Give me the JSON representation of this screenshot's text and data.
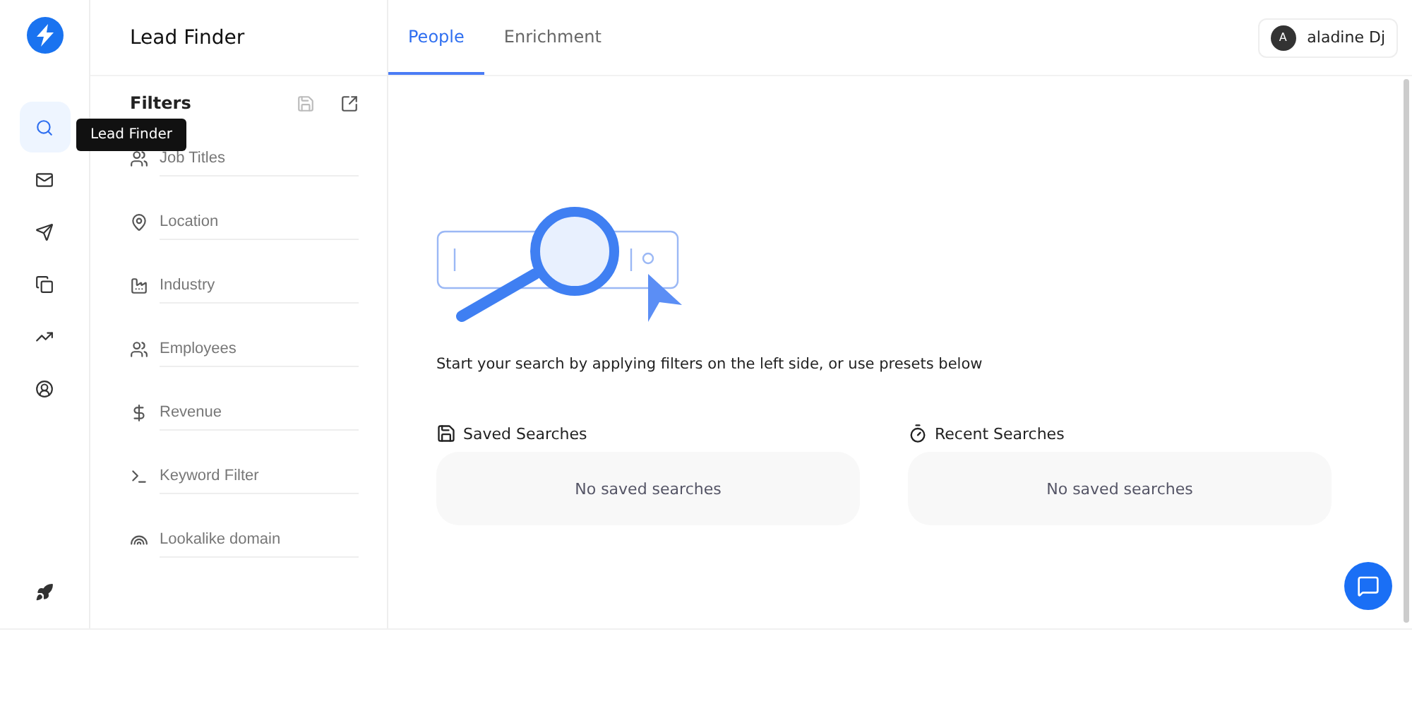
{
  "app": {
    "title": "Lead Finder"
  },
  "nav": [
    {
      "kind": "search",
      "selected": true
    },
    {
      "kind": "mail",
      "selected": false
    },
    {
      "kind": "send",
      "selected": false
    },
    {
      "kind": "copy",
      "selected": false
    },
    {
      "kind": "trend",
      "selected": false
    },
    {
      "kind": "user",
      "selected": false
    }
  ],
  "nav_bottom": {
    "kind": "rocket"
  },
  "tooltip": "Lead Finder",
  "filters": {
    "title": "Filters",
    "items": [
      {
        "kind": "users",
        "label": "Job Titles"
      },
      {
        "kind": "pin",
        "label": "Location"
      },
      {
        "kind": "building",
        "label": "Industry"
      },
      {
        "kind": "group",
        "label": "Employees"
      },
      {
        "kind": "dollar",
        "label": "Revenue"
      },
      {
        "kind": "terminal",
        "label": "Keyword Filter"
      },
      {
        "kind": "rainbow",
        "label": "Lookalike domain"
      }
    ]
  },
  "tabs": [
    {
      "label": "People",
      "selected": true
    },
    {
      "label": "Enrichment",
      "selected": false
    }
  ],
  "user": {
    "initial": "A",
    "name": "aladine Dj"
  },
  "hint": "Start your search by applying filters on the left side, or use presets below",
  "panels": [
    {
      "kind": "saved",
      "title": "Saved Searches",
      "empty": "No saved searches"
    },
    {
      "kind": "recent",
      "title": "Recent Searches",
      "empty": "No saved searches"
    }
  ]
}
